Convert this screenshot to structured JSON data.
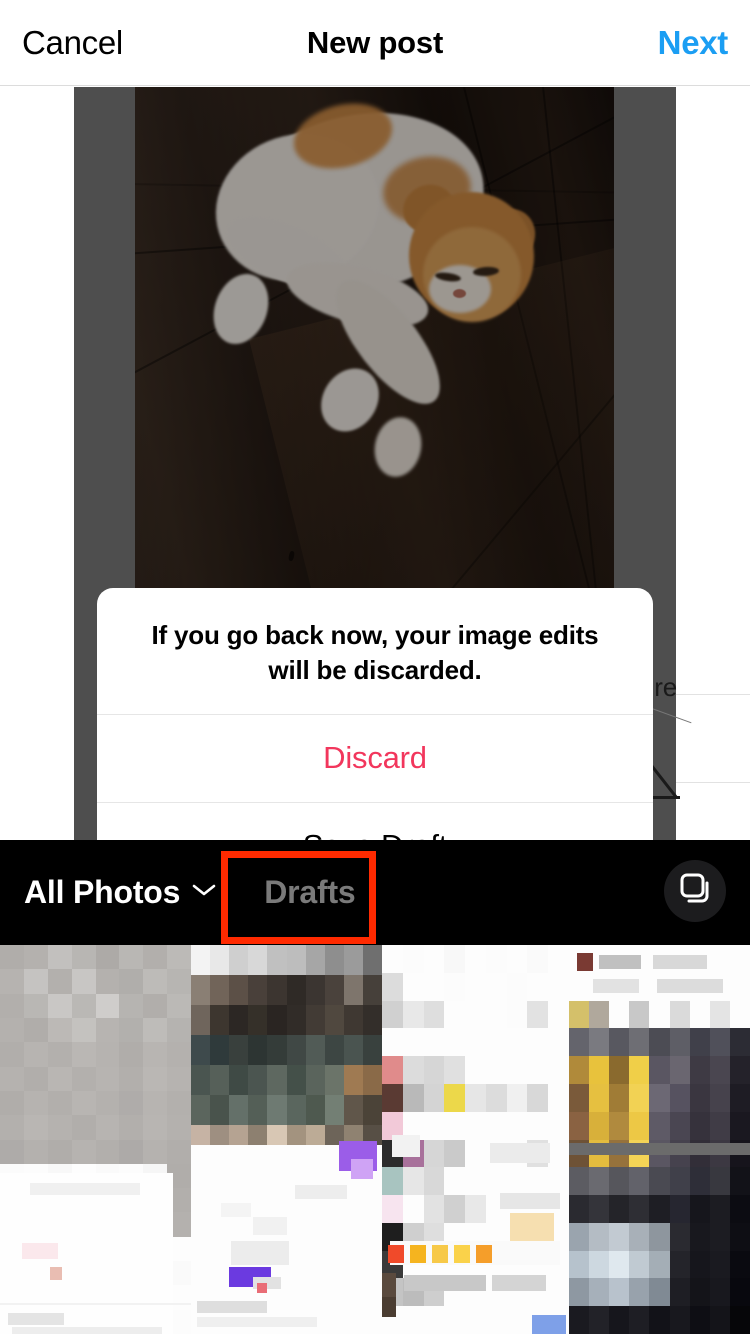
{
  "header": {
    "cancel_label": "Cancel",
    "title": "New post",
    "next_label": "Next",
    "next_color": "#1b9ef3"
  },
  "preview": {
    "expand_icon": "expand-corners-icon",
    "image_description": "orange and white cat lying on dark wood floor",
    "letterbox_color": "#4e4e4e"
  },
  "background_remnant": {
    "partial_text": "ure"
  },
  "dialog": {
    "message": "If you go back now, your image edits will be discarded.",
    "actions": [
      {
        "label": "Discard",
        "color": "#f2365c",
        "destructive": true
      },
      {
        "label": "Save Draft",
        "color": "#000000",
        "destructive": false
      }
    ]
  },
  "toolbar": {
    "album_label": "All Photos",
    "album_chevron_icon": "chevron-down-icon",
    "drafts_label": "Drafts",
    "drafts_color": "#7a7a7a",
    "multiselect_icon": "multi-select-icon",
    "background_color": "#000000"
  },
  "annotation": {
    "shape": "rectangle",
    "color": "#ff2a00",
    "target": "Drafts"
  },
  "gallery": {
    "columns": 4,
    "thumbnails": [
      {
        "name": "thumbnail-1",
        "description": "blurred light gray document"
      },
      {
        "name": "thumbnail-2",
        "description": "blurred dark green collage"
      },
      {
        "name": "thumbnail-3",
        "description": "blurred white app screenshot"
      },
      {
        "name": "thumbnail-4",
        "description": "blurred yellow and dark photo"
      }
    ]
  }
}
